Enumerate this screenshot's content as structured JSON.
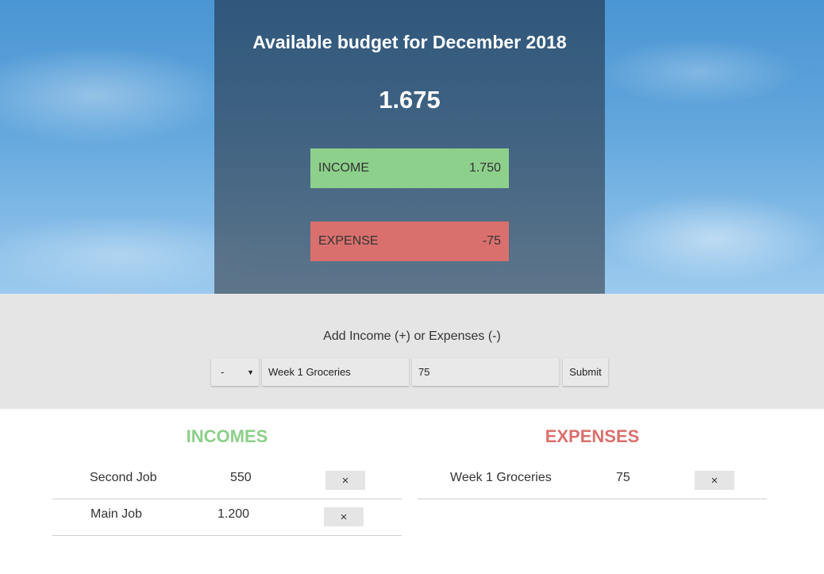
{
  "header": {
    "title": "Available budget for December 2018",
    "budget": "1.675",
    "income": {
      "label": "INCOME",
      "value": "1.750",
      "color": "#8dd08b"
    },
    "expense": {
      "label": "EXPENSE",
      "value": "-75",
      "color": "#d9706d"
    }
  },
  "add": {
    "title": "Add Income (+) or Expenses (-)",
    "type_value": "-",
    "type_arrow_icon": "caret-down-icon",
    "description_value": "Week 1 Groceries",
    "value_value": "75",
    "submit_label": "Submit"
  },
  "incomes": {
    "title": "INCOMES",
    "items": [
      {
        "description": "Second Job",
        "value": "550",
        "delete_icon": "×"
      },
      {
        "description": "Main Job",
        "value": "1.200",
        "delete_icon": "×"
      }
    ]
  },
  "expenses": {
    "title": "EXPENSES",
    "items": [
      {
        "description": "Week 1 Groceries",
        "value": "75",
        "delete_icon": "×"
      }
    ]
  }
}
